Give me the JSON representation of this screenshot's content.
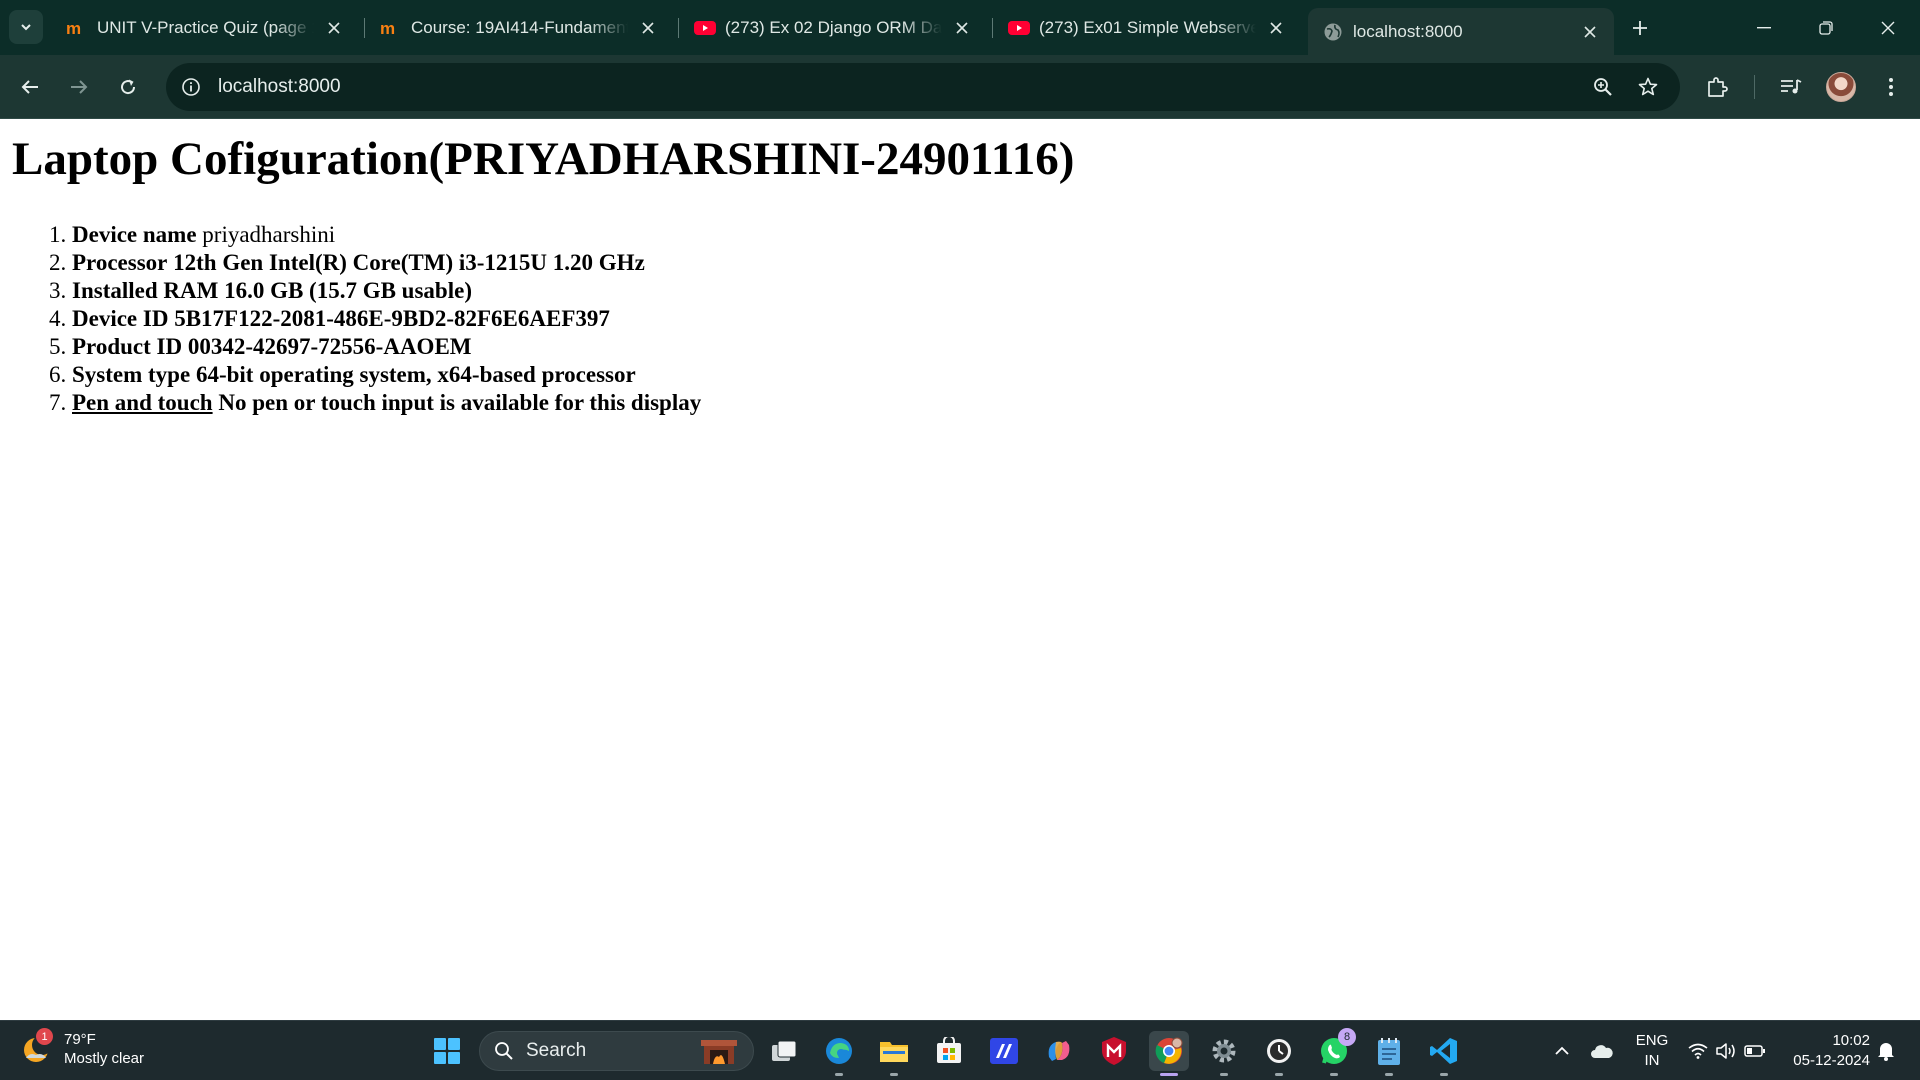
{
  "tabs": [
    {
      "title": "UNIT V-Practice Quiz (page 1",
      "icon": "moodle-icon"
    },
    {
      "title": "Course: 19AI414-Fundamenta",
      "icon": "moodle-icon"
    },
    {
      "title": "(273) Ex 02 Django ORM Data",
      "icon": "youtube-icon"
    },
    {
      "title": "(273) Ex01 Simple Webserver",
      "icon": "youtube-icon"
    },
    {
      "title": "localhost:8000",
      "icon": "globe-icon"
    }
  ],
  "address": {
    "url": "localhost:8000"
  },
  "page": {
    "heading": "Laptop Cofiguration(PRIYADHARSHINI-24901116)",
    "items": [
      {
        "label": "Device name",
        "value": "priyadharshini"
      },
      {
        "label": "Processor",
        "value": "12th Gen Intel(R) Core(TM) i3-1215U 1.20 GHz"
      },
      {
        "label": "Installed RAM",
        "value": "16.0 GB (15.7 GB usable)"
      },
      {
        "label": "Device ID",
        "value": "5B17F122-2081-486E-9BD2-82F6E6AEF397"
      },
      {
        "label": "Product ID",
        "value": "00342-42697-72556-AAOEM"
      },
      {
        "label": "System type",
        "value": "64-bit operating system, x64-based processor"
      },
      {
        "label": "Pen and touch",
        "value": "No pen or touch input is available for this display"
      }
    ]
  },
  "taskbar": {
    "weather": {
      "temp": "79°F",
      "condition": "Mostly clear",
      "badge": "1"
    },
    "search_label": "Search",
    "whatsapp_badge": "8",
    "language": {
      "line1": "ENG",
      "line2": "IN"
    },
    "clock": {
      "time": "10:02",
      "date": "05-12-2024"
    }
  },
  "colors": {
    "tabstrip": "#0c2d28",
    "toolbar": "#1d3733",
    "taskbar": "#1e2a2e",
    "youtube": "#ff0033",
    "moodle": "#f98012"
  }
}
